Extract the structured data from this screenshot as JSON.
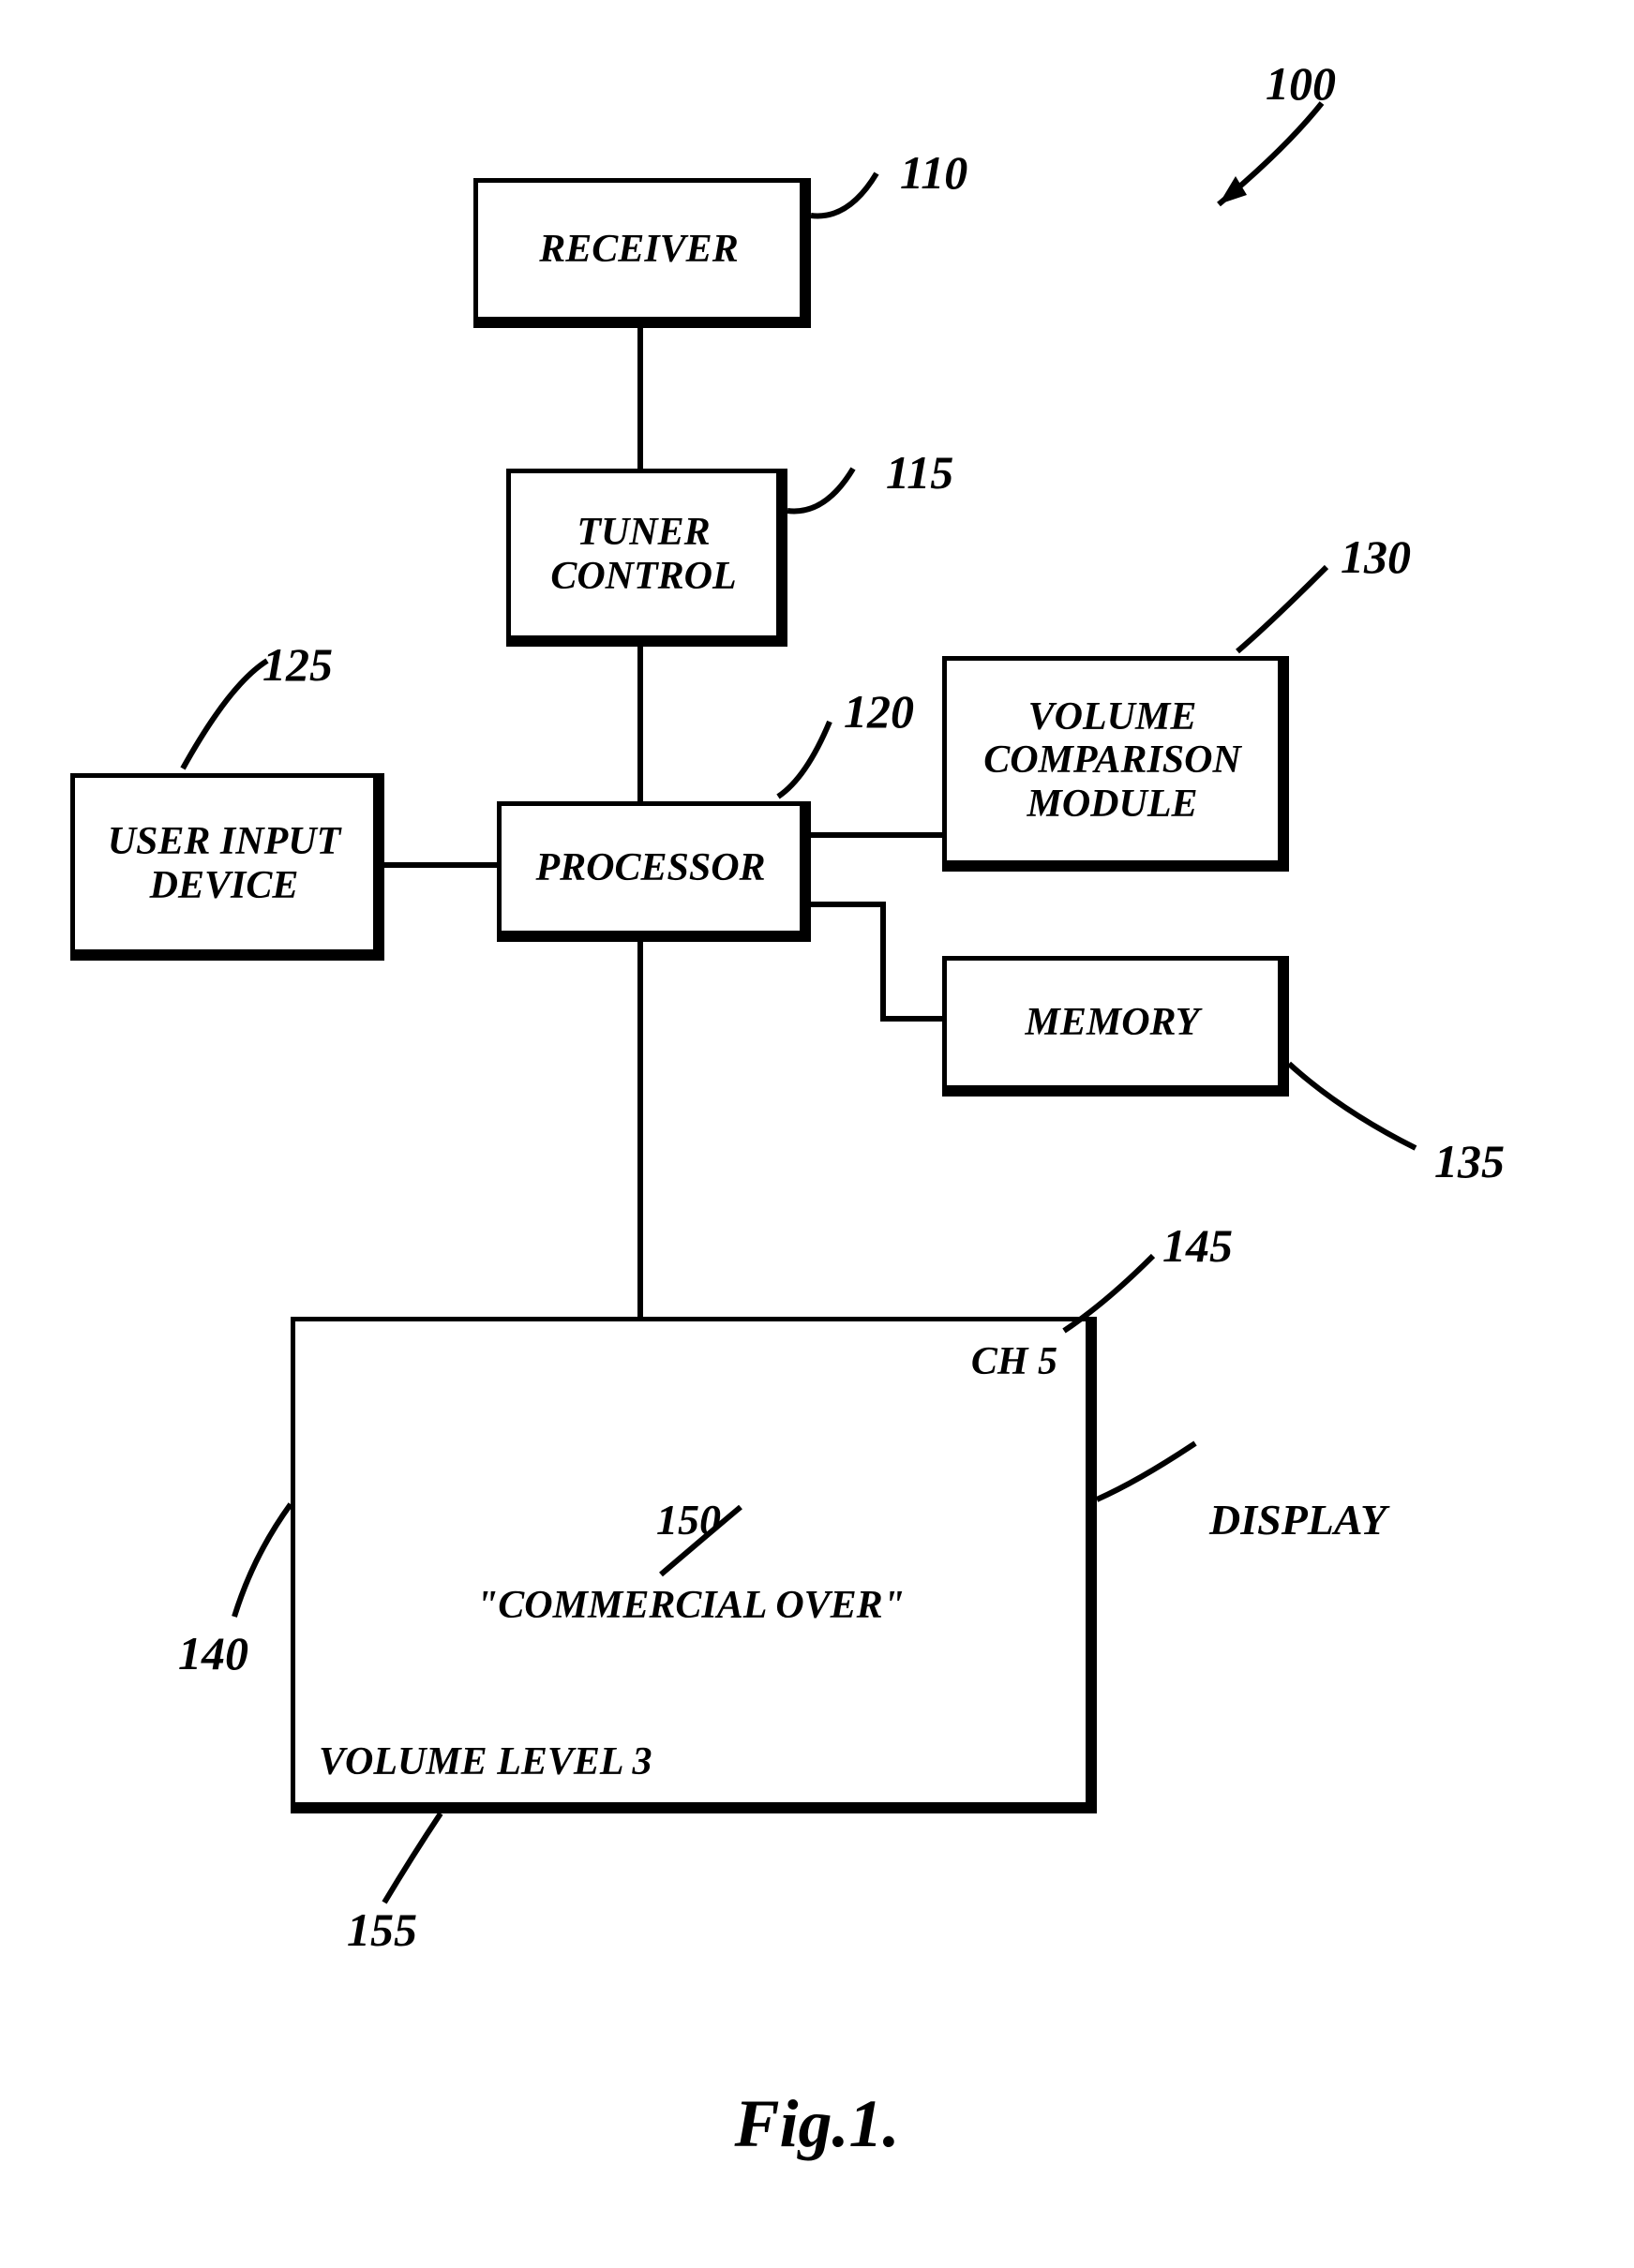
{
  "refs": {
    "system": "100",
    "receiver": "110",
    "tuner": "115",
    "processor": "120",
    "user_input": "125",
    "volume_module": "130",
    "memory": "135",
    "display": "140",
    "channel": "145",
    "message": "150",
    "volume_level": "155"
  },
  "blocks": {
    "receiver": "RECEIVER",
    "tuner": "TUNER CONTROL",
    "processor": "PROCESSOR",
    "user_input": "USER INPUT DEVICE",
    "volume_module": "VOLUME COMPARISON MODULE",
    "memory": "MEMORY"
  },
  "display": {
    "label": "DISPLAY",
    "channel": "CH 5",
    "message": "\"COMMERCIAL OVER\"",
    "volume": "VOLUME LEVEL 3"
  },
  "figure": "Fig.1."
}
